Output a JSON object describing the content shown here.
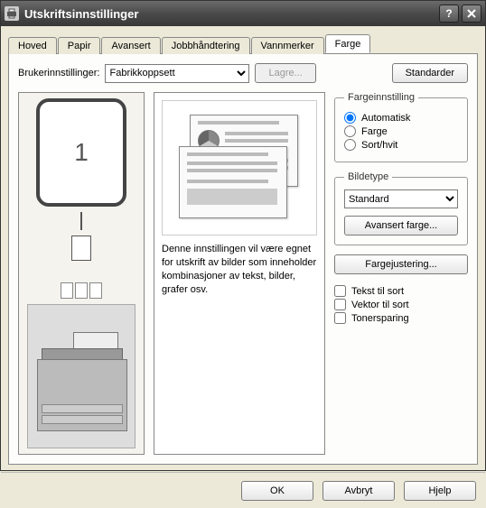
{
  "window": {
    "title": "Utskriftsinnstillinger"
  },
  "tabs": {
    "items": [
      {
        "label": "Hoved"
      },
      {
        "label": "Papir"
      },
      {
        "label": "Avansert"
      },
      {
        "label": "Jobbhåndtering"
      },
      {
        "label": "Vannmerker"
      },
      {
        "label": "Farge"
      }
    ],
    "active_index": 5
  },
  "user_settings": {
    "label": "Brukerinnstillinger:",
    "value": "Fabrikkoppsett",
    "save_label": "Lagre...",
    "defaults_label": "Standarder"
  },
  "preview": {
    "page_number": "1"
  },
  "description": {
    "text": "Denne innstillingen vil være egnet for utskrift av bilder som inneholder kombinasjoner av tekst, bilder, grafer osv."
  },
  "color_setting": {
    "legend": "Fargeinnstilling",
    "options": [
      {
        "label": "Automatisk",
        "checked": true
      },
      {
        "label": "Farge",
        "checked": false
      },
      {
        "label": "Sort/hvit",
        "checked": false
      }
    ]
  },
  "image_type": {
    "legend": "Bildetype",
    "value": "Standard",
    "advanced_label": "Avansert farge...",
    "adjust_label": "Fargejustering..."
  },
  "checks": {
    "items": [
      {
        "label": "Tekst til sort",
        "checked": false
      },
      {
        "label": "Vektor til sort",
        "checked": false
      },
      {
        "label": "Tonersparing",
        "checked": false
      }
    ]
  },
  "buttons": {
    "ok": "OK",
    "cancel": "Avbryt",
    "help": "Hjelp"
  }
}
